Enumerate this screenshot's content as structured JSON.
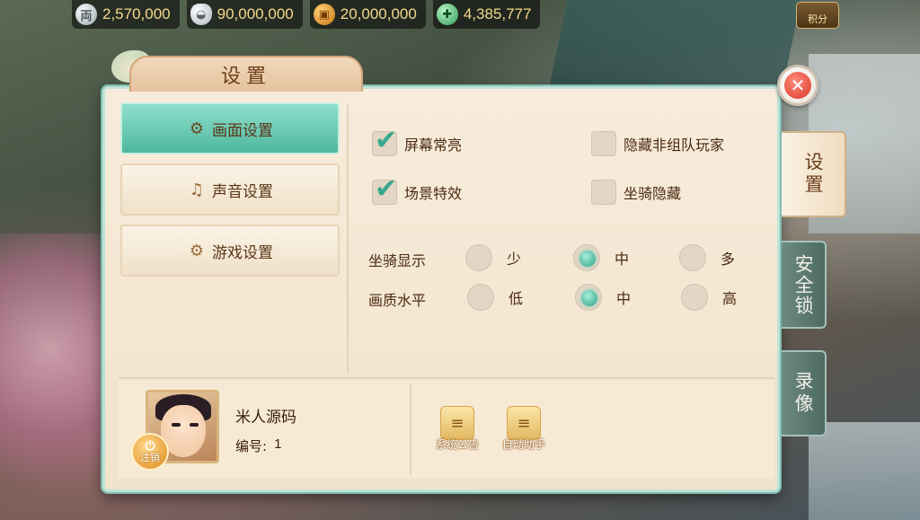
{
  "currencies": [
    {
      "icon": "silver-coin-icon",
      "glyph": "両",
      "value": "2,570,000"
    },
    {
      "icon": "silver-ingot-icon",
      "glyph": "◒",
      "value": "90,000,000"
    },
    {
      "icon": "copper-coin-icon",
      "glyph": "▣",
      "value": "20,000,000"
    },
    {
      "icon": "jade-icon",
      "glyph": "✚",
      "value": "4,385,777"
    }
  ],
  "score_button": {
    "label": "积分"
  },
  "dialog": {
    "title": "设置",
    "close_glyph": "✕"
  },
  "menu": [
    {
      "label": "画面设置",
      "glyph": "⚙",
      "active": true
    },
    {
      "label": "声音设置",
      "glyph": "♫",
      "active": false
    },
    {
      "label": "游戏设置",
      "glyph": "⚙",
      "active": false
    }
  ],
  "checkboxes": {
    "screen_on": {
      "label": "屏幕常亮",
      "checked": true
    },
    "hide_players": {
      "label": "隐藏非组队玩家",
      "checked": false
    },
    "scene_effects": {
      "label": "场景特效",
      "checked": true
    },
    "hide_mount": {
      "label": "坐骑隐藏",
      "checked": false
    },
    "tick_glyph": "✔"
  },
  "mount_display": {
    "label": "坐骑显示",
    "options": [
      "少",
      "中",
      "多"
    ],
    "selected": "中"
  },
  "quality": {
    "label": "画质水平",
    "options": [
      "低",
      "中",
      "高"
    ],
    "selected": "中"
  },
  "player": {
    "name": "米人源码",
    "id_label": "编号:",
    "id_value": "1",
    "logout_label": "注销",
    "logout_glyph": "⏻"
  },
  "actions": [
    {
      "label": "系统公告",
      "glyph": "≡"
    },
    {
      "label": "自动助手",
      "glyph": "≡"
    }
  ],
  "side_tabs": [
    {
      "label": "设置",
      "active": true
    },
    {
      "label": "安全锁",
      "active": false
    },
    {
      "label": "录像",
      "active": false
    }
  ],
  "colors": {
    "accent": "#4fb79f",
    "panel": "#f4e7d1",
    "title_text": "#6b3f1c",
    "currency_text": "#f4d889"
  }
}
